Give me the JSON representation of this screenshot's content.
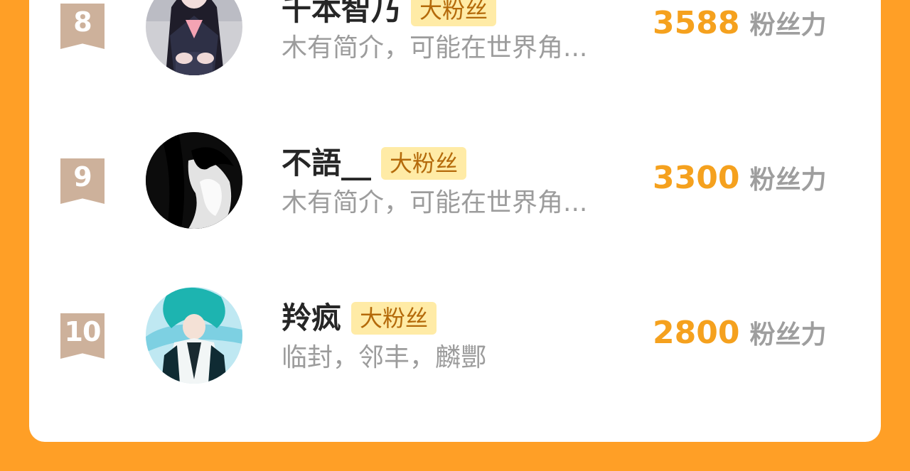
{
  "colors": {
    "background": "#FF9F26",
    "panel": "#FFFFFF",
    "rank_ribbon": "#CDB19B",
    "badge_bg": "#FFEBA6",
    "badge_text": "#B46A0A",
    "score": "#F5A11E",
    "muted": "#9E9E9E"
  },
  "ranking": {
    "rows": [
      {
        "rank": "8",
        "name": "千本智乃",
        "badge": "大粉丝",
        "bio": "木有简介，可能在世界角...",
        "score": "3588",
        "score_unit": "粉丝力",
        "avatar_icon": "avatar-anime-girl-sailor-uniform"
      },
      {
        "rank": "9",
        "name": "不語__",
        "badge": "大粉丝",
        "bio": "木有简介，可能在世界角...",
        "score": "3300",
        "score_unit": "粉丝力",
        "avatar_icon": "avatar-monochrome-portrait"
      },
      {
        "rank": "10",
        "name": "羚疯",
        "badge": "大粉丝",
        "bio": "临封，邻丰，麟酆",
        "score": "2800",
        "score_unit": "粉丝力",
        "avatar_icon": "avatar-anime-warrior-teal"
      }
    ]
  }
}
